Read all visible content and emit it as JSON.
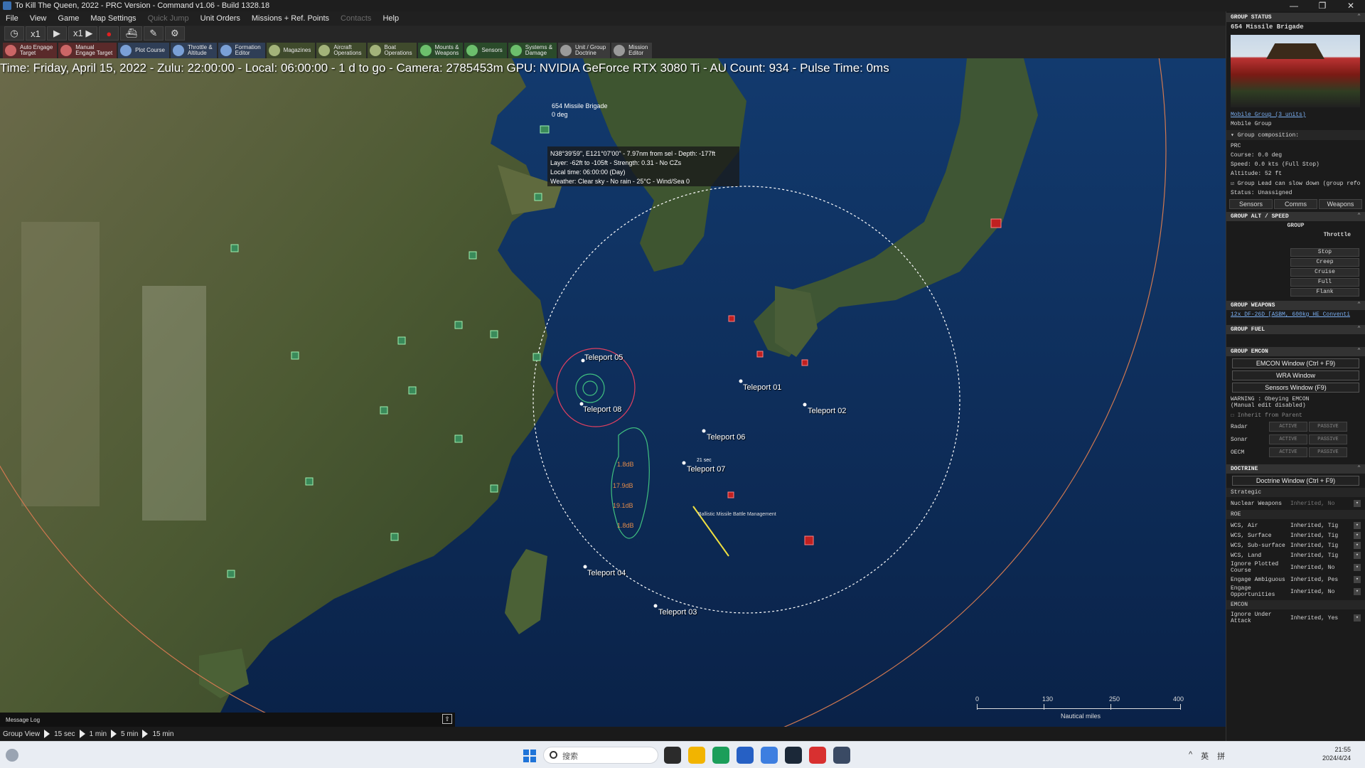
{
  "window": {
    "title": "To Kill The Queen, 2022 - PRC Version - Command v1.06 - Build 1328.18",
    "minimize": "—",
    "restore": "❐",
    "close": "✕"
  },
  "menu": [
    {
      "label": "File",
      "disabled": false
    },
    {
      "label": "View",
      "disabled": false
    },
    {
      "label": "Game",
      "disabled": false
    },
    {
      "label": "Map Settings",
      "disabled": false
    },
    {
      "label": "Quick Jump",
      "disabled": true
    },
    {
      "label": "Unit Orders",
      "disabled": false
    },
    {
      "label": "Missions + Ref. Points",
      "disabled": false
    },
    {
      "label": "Contacts",
      "disabled": true
    },
    {
      "label": "Help",
      "disabled": false
    }
  ],
  "sim_controls": {
    "clock_icon": "clock-icon",
    "speed1": "x1",
    "play": "▶",
    "speed2": "x1 ▶",
    "record": "●"
  },
  "toolbar_buttons": [
    {
      "label": "Auto Engage\nTarget",
      "style": "red",
      "icon": "target-icon"
    },
    {
      "label": "Manual\nEngage Target",
      "style": "red",
      "icon": "crosshair-icon"
    },
    {
      "label": "Plot Course",
      "style": "blue",
      "icon": "course-icon"
    },
    {
      "label": "Throttle &\nAltitude",
      "style": "blue",
      "icon": "throttle-icon"
    },
    {
      "label": "Formation\nEditor",
      "style": "blue",
      "icon": "formation-icon"
    },
    {
      "label": "Magazines",
      "style": "olive",
      "icon": "magazine-icon"
    },
    {
      "label": "Aircraft\nOperations",
      "style": "olive",
      "icon": "aircraft-icon"
    },
    {
      "label": "Boat\nOperations",
      "style": "olive",
      "icon": "boat-icon"
    },
    {
      "label": "Mounts &\nWeapons",
      "style": "green",
      "icon": "weapons-icon"
    },
    {
      "label": "Sensors",
      "style": "green",
      "icon": "sensor-icon"
    },
    {
      "label": "Systems &\nDamage",
      "style": "green",
      "icon": "systems-icon"
    },
    {
      "label": "Unit / Group\nDoctrine",
      "style": "grey",
      "icon": "doctrine-icon"
    },
    {
      "label": "Mission\nEditor",
      "style": "grey",
      "icon": "mission-icon"
    }
  ],
  "status_line": "Time: Friday, April 15, 2022 - Zulu: 22:00:00 - Local: 06:00:00 - 1 d to go -  Camera: 2785453m  GPU: NVIDIA GeForce RTX 3080 Ti - AU Count: 934 - Pulse Time: 0ms",
  "map": {
    "selected_unit_label": "654 Missile Brigade",
    "selected_unit_course": "0 deg",
    "tooltip": [
      "N38°39'59\", E121°07'00\" - 7.97nm from sel - Depth: -177ft",
      "Layer: -62ft to -105ft - Strength: 0.31 - No CZs",
      "Local time: 06:00:00 (Day)",
      "Weather: Clear sky - No rain - 25°C - Wind/Sea 0"
    ],
    "teleport_points": [
      "Teleport 05",
      "Teleport 08",
      "Teleport 01",
      "Teleport 02",
      "Teleport 06",
      "Teleport 07",
      "Teleport 04",
      "Teleport 03"
    ],
    "track_labels": [
      "1.8dB",
      "17.9dB",
      "19.1dB",
      "1.8dB"
    ],
    "bm_label": "Ballistic Missile Battle Management",
    "time_mark": "21 sec",
    "scale": {
      "ticks": [
        "0",
        "130",
        "250",
        "400"
      ],
      "unit": "Nautical miles"
    }
  },
  "panel": {
    "group_status_header": "GROUP STATUS",
    "unit_name": "654 Missile Brigade",
    "group_link": "Mobile Group (3 units)",
    "group_type": "Mobile Group",
    "composition_label": "Group composition:",
    "side": "PRC",
    "course": "Course: 0.0 deg",
    "speed": "Speed: 0.0 kts (Full Stop)",
    "altitude": "Altitude: 52 ft",
    "group_lead_note": "Group Lead can slow down (group refo",
    "status": "Status: Unassigned",
    "tabs": [
      "Sensors",
      "Comms",
      "Weapons"
    ],
    "alt_speed_header": "GROUP ALT / SPEED",
    "group_label": "GROUP",
    "throttle_label": "Throttle",
    "throttle_options": [
      "Stop",
      "Creep",
      "Cruise",
      "Full",
      "Flank"
    ],
    "weapons_header": "GROUP WEAPONS",
    "weapons_line": "12x DF-26D [ASBM, 600kg HE Conventi",
    "fuel_header": "GROUP FUEL",
    "emcon_header": "GROUP EMCON",
    "emcon_buttons": [
      "EMCON Window (Ctrl + F9)",
      "WRA Window",
      "Sensors Window (F9)"
    ],
    "emcon_warning": "WARNING : Obeying EMCON\n(Manual edit disabled)",
    "inherit_label": "Inherit from Parent",
    "emcon_rows": [
      {
        "label": "Radar",
        "active": "ACTIVE",
        "passive": "PASSIVE"
      },
      {
        "label": "Sonar",
        "active": "ACTIVE",
        "passive": "PASSIVE"
      },
      {
        "label": "OECM",
        "active": "ACTIVE",
        "passive": "PASSIVE"
      }
    ],
    "doctrine_header": "DOCTRINE",
    "doctrine_button": "Doctrine Window (Ctrl + F9)",
    "strategic_label": "Strategic",
    "nuclear_label": "Nuclear Weapons",
    "nuclear_value": "Inherited, No",
    "roe_label": "ROE",
    "doctrine_rows": [
      {
        "label": "WCS, Air",
        "value": "Inherited, Tig"
      },
      {
        "label": "WCS, Surface",
        "value": "Inherited, Tig"
      },
      {
        "label": "WCS, Sub-surface",
        "value": "Inherited, Tig"
      },
      {
        "label": "WCS, Land",
        "value": "Inherited, Tig"
      },
      {
        "label": "Ignore Plotted Course",
        "value": "Inherited, No"
      },
      {
        "label": "Engage Ambiguous",
        "value": "Inherited, Pes"
      },
      {
        "label": "Engage Opportunities",
        "value": "Inherited, No"
      }
    ],
    "emcon_sub_label": "EMCON",
    "ignore_attack_label": "Ignore Under Attack",
    "ignore_attack_value": "Inherited, Yes"
  },
  "bottom": {
    "message_log": "Message Log",
    "group_view": "Group View",
    "steps": [
      "15 sec",
      "1 min",
      "5 min",
      "15 min"
    ]
  },
  "taskbar": {
    "search_placeholder": "搜索",
    "tray_items": [
      "^",
      "英",
      "拼"
    ],
    "time": "21:55",
    "date": "2024/4/24"
  }
}
